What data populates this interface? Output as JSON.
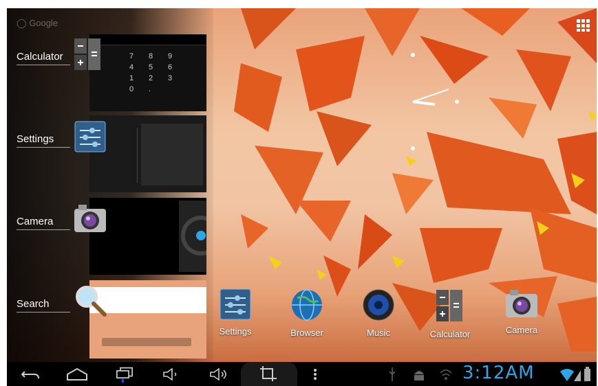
{
  "search_hint": "Google",
  "recents": [
    {
      "label": "Calculator"
    },
    {
      "label": "Settings"
    },
    {
      "label": "Camera"
    },
    {
      "label": "Search"
    }
  ],
  "calculator_keys": [
    "7",
    "8",
    "9",
    "4",
    "5",
    "6",
    "1",
    "2",
    "3",
    "0",
    "."
  ],
  "dock": [
    {
      "label": "Settings",
      "icon": "settings-icon"
    },
    {
      "label": "Browser",
      "icon": "globe-icon"
    },
    {
      "label": "Music",
      "icon": "speaker-icon"
    },
    {
      "label": "Calculator",
      "icon": "calculator-icon"
    },
    {
      "label": "Camera",
      "icon": "camera-icon"
    }
  ],
  "status": {
    "time": "3:12AM"
  },
  "colors": {
    "accent": "#2aa7e4",
    "wallpaper_orange": "#e2541a"
  }
}
